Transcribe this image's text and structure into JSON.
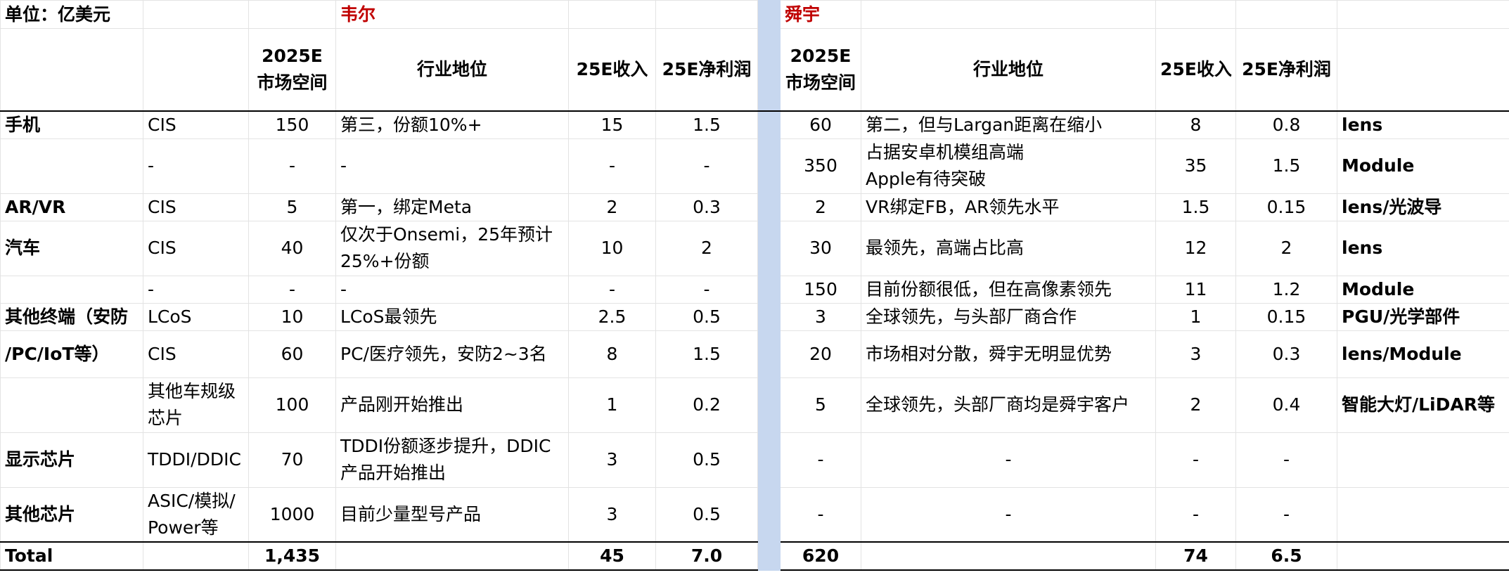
{
  "title": {
    "unit": "单位：亿美元",
    "company_left": "韦尔",
    "company_right": "舜宇"
  },
  "headers": {
    "market_line1": "2025E",
    "market_line2": "市场空间",
    "position": "行业地位",
    "revenue": "25E收入",
    "profit": "25E净利润"
  },
  "colors": {
    "brand_red": "#c00000",
    "separator_blue": "#c7d7ef"
  },
  "rows": [
    {
      "seg": "手机",
      "prod": [
        "CIS"
      ],
      "w_mkt": "150",
      "w_pos": [
        "第三，份额10%+"
      ],
      "w_rev": "15",
      "w_prof": "1.5",
      "s_mkt": "60",
      "s_pos": [
        "第二，但与Largan距离在缩小"
      ],
      "s_rev": "8",
      "s_prof": "0.8",
      "s_prod": "lens"
    },
    {
      "seg": "",
      "prod": [
        "-"
      ],
      "w_mkt": "-",
      "w_pos": [
        "-"
      ],
      "w_rev": "-",
      "w_prof": "-",
      "s_mkt": "350",
      "s_pos": [
        "占据安卓机模组高端",
        "Apple有待突破"
      ],
      "s_rev": "35",
      "s_prof": "1.5",
      "s_prod": "Module"
    },
    {
      "seg": "AR/VR",
      "prod": [
        "CIS"
      ],
      "w_mkt": "5",
      "w_pos": [
        "第一，绑定Meta"
      ],
      "w_rev": "2",
      "w_prof": "0.3",
      "s_mkt": "2",
      "s_pos": [
        "VR绑定FB，AR领先水平"
      ],
      "s_rev": "1.5",
      "s_prof": "0.15",
      "s_prod": "lens/光波导"
    },
    {
      "seg": "汽车",
      "prod": [
        "CIS"
      ],
      "w_mkt": "40",
      "w_pos": [
        "仅次于Onsemi，25年预计",
        "25%+份额"
      ],
      "w_rev": "10",
      "w_prof": "2",
      "s_mkt": "30",
      "s_pos": [
        "最领先，高端占比高"
      ],
      "s_rev": "12",
      "s_prof": "2",
      "s_prod": "lens"
    },
    {
      "seg": "",
      "prod": [
        "-"
      ],
      "w_mkt": "-",
      "w_pos": [
        "-"
      ],
      "w_rev": "-",
      "w_prof": "-",
      "s_mkt": "150",
      "s_pos": [
        "目前份额很低，但在高像素领先"
      ],
      "s_rev": "11",
      "s_prof": "1.2",
      "s_prod": "Module"
    },
    {
      "seg": "其他终端（安防",
      "prod": [
        "LCoS"
      ],
      "w_mkt": "10",
      "w_pos": [
        "LCoS最领先"
      ],
      "w_rev": "2.5",
      "w_prof": "0.5",
      "s_mkt": "3",
      "s_pos": [
        "全球领先，与头部厂商合作"
      ],
      "s_rev": "1",
      "s_prof": "0.15",
      "s_prod": "PGU/光学部件"
    },
    {
      "seg": "/PC/IoT等）",
      "prod": [
        "CIS"
      ],
      "w_mkt": "60",
      "w_pos": [
        "PC/医疗领先，安防2~3名"
      ],
      "w_rev": "8",
      "w_prof": "1.5",
      "s_mkt": "20",
      "s_pos": [
        "市场相对分散，舜宇无明显优势"
      ],
      "s_rev": "3",
      "s_prof": "0.3",
      "s_prod": "lens/Module"
    },
    {
      "seg": "",
      "prod": [
        "其他车规级",
        "芯片"
      ],
      "w_mkt": "100",
      "w_pos": [
        "产品刚开始推出"
      ],
      "w_rev": "1",
      "w_prof": "0.2",
      "s_mkt": "5",
      "s_pos": [
        "全球领先，头部厂商均是舜宇客户"
      ],
      "s_rev": "2",
      "s_prof": "0.4",
      "s_prod": "智能大灯/LiDAR等"
    },
    {
      "seg": "显示芯片",
      "prod": [
        "TDDI/DDIC"
      ],
      "w_mkt": "70",
      "w_pos": [
        "TDDI份额逐步提升，DDIC",
        "产品开始推出"
      ],
      "w_rev": "3",
      "w_prof": "0.5",
      "s_mkt": "-",
      "s_pos": [
        "-"
      ],
      "s_rev": "-",
      "s_prof": "-",
      "s_prod": ""
    },
    {
      "seg": "其他芯片",
      "prod": [
        "ASIC/模拟/",
        "Power等"
      ],
      "w_mkt": "1000",
      "w_pos": [
        "目前少量型号产品"
      ],
      "w_rev": "3",
      "w_prof": "0.5",
      "s_mkt": "-",
      "s_pos": [
        "-"
      ],
      "s_rev": "-",
      "s_prof": "-",
      "s_prod": ""
    }
  ],
  "total": {
    "label": "Total",
    "w_mkt": "1,435",
    "w_rev": "45",
    "w_prof": "7.0",
    "s_mkt": "620",
    "s_rev": "74",
    "s_prof": "6.5"
  }
}
